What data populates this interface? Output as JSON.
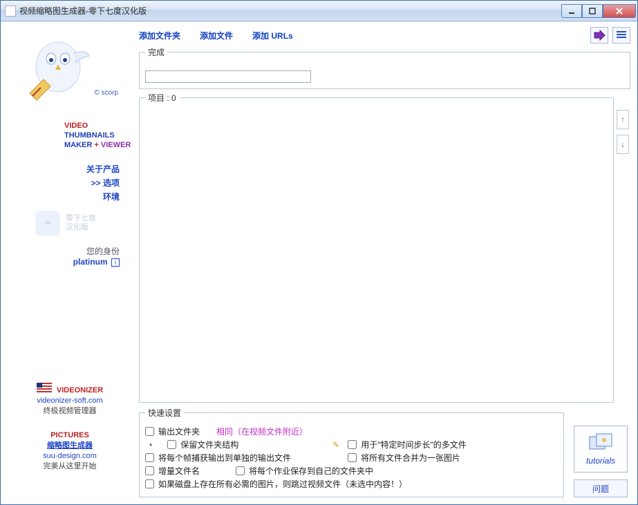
{
  "titlebar": {
    "text": "视频缩略图生成器-零下七度汉化版"
  },
  "logo": {
    "scorp": "© scorp",
    "line1": "VIDEO",
    "line2": "THUMBNAILS",
    "line3a": "MAKER",
    "line3b": "+",
    "line3c": "VIEWER"
  },
  "nav": {
    "about": "关于产品",
    "options": ">> 选项",
    "env": "环境"
  },
  "smallbox": {
    "l1": "零下七度",
    "l2": "汉化版"
  },
  "identity": {
    "l1": "您的身份",
    "plat": "platinum"
  },
  "videonizer": {
    "title": "VIDEONIZER",
    "link": "videonizer-soft.com",
    "desc": "终极视频管理器"
  },
  "pictures": {
    "title": "PICTURES",
    "sub": "缩略图生成器",
    "link": "suu-design.com",
    "desc": "完美从这里开始"
  },
  "top": {
    "addFolder": "添加文件夹",
    "addFile": "添加文件",
    "addUrls": "添加 URLs"
  },
  "fs": {
    "complete": "完成",
    "items": "项目 : 0",
    "quick": "快速设置"
  },
  "quick": {
    "outFolder": "输出文件夹",
    "same": "相同（在视频文件附近）",
    "keepStruct": "保留文件夹结构",
    "forTime": "用于\"特定时间步长\"的多文件",
    "eachFrame": "将每个帧捕获输出到单独的输出文件",
    "mergeOne": "将所有文件合并为一张图片",
    "incName": "增量文件名",
    "eachJobFolder": "将每个作业保存到自己的文件夹中",
    "skipIf": "如果磁盘上存在所有必需的图片，则跳过视频文件（未选中内容！）"
  },
  "right": {
    "tutorials": "tutorials",
    "question": "问题"
  }
}
